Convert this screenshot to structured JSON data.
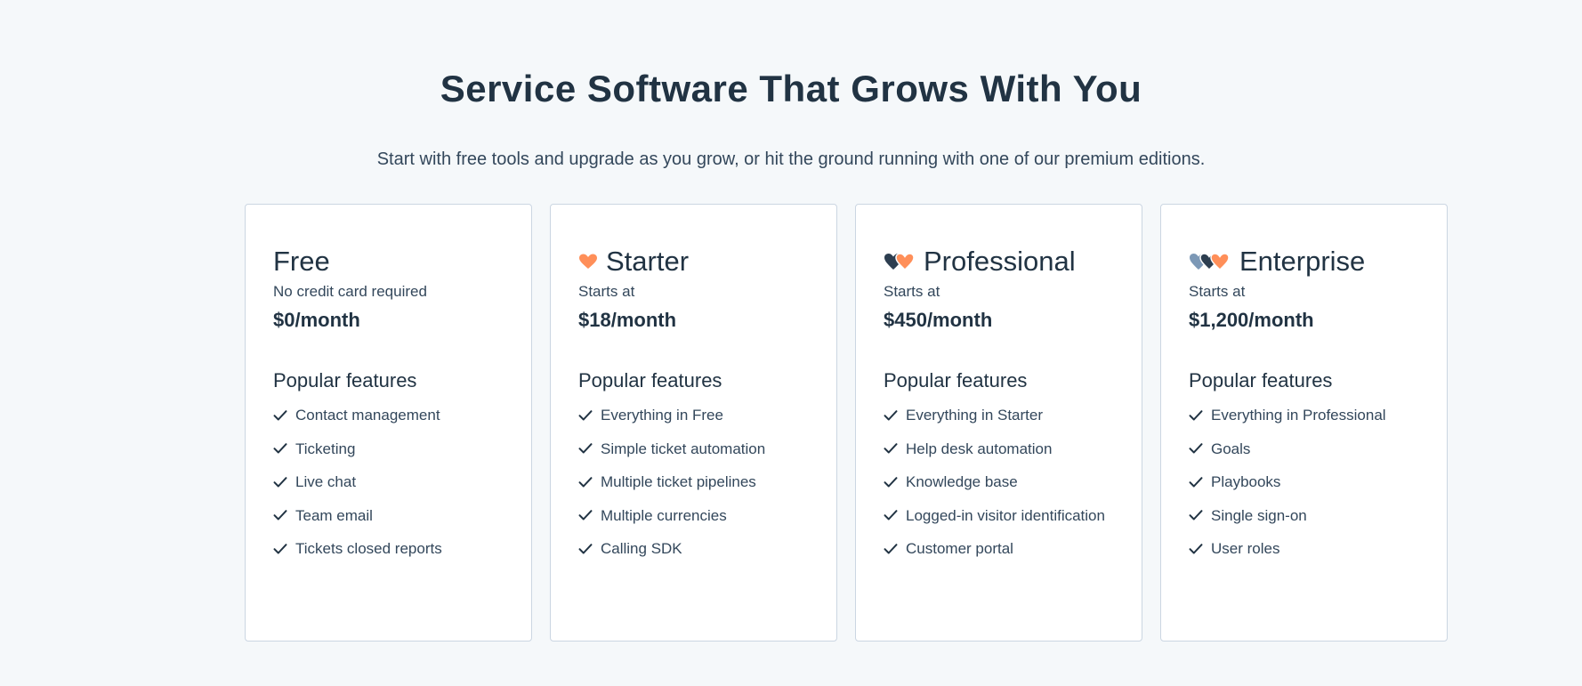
{
  "page": {
    "title": "Service Software That Grows With You",
    "subtitle": "Start with free tools and upgrade as you grow, or hit the ground running with one of our premium editions."
  },
  "colors": {
    "background": "#f5f8fa",
    "heading": "#213343",
    "text": "#33475b",
    "card_border": "#cbd6e2",
    "heart_orange": "#ff8f59",
    "heart_dark": "#2d3e50",
    "heart_gray": "#7c98b6"
  },
  "plans": [
    {
      "name": "Free",
      "icon": null,
      "subtext": "No credit card required",
      "price": "$0/month",
      "features_title": "Popular features",
      "features": [
        "Contact management",
        "Ticketing",
        "Live chat",
        "Team email",
        "Tickets closed reports"
      ]
    },
    {
      "name": "Starter",
      "icon": "heart-icon",
      "subtext": "Starts at",
      "price": "$18/month",
      "features_title": "Popular features",
      "features": [
        "Everything in Free",
        "Simple ticket automation",
        "Multiple ticket pipelines",
        "Multiple currencies",
        "Calling SDK"
      ]
    },
    {
      "name": "Professional",
      "icon": "two-hearts-icon",
      "subtext": "Starts at",
      "price": "$450/month",
      "features_title": "Popular features",
      "features": [
        "Everything in Starter",
        "Help desk automation",
        "Knowledge base",
        "Logged-in visitor identification",
        "Customer portal"
      ]
    },
    {
      "name": "Enterprise",
      "icon": "three-hearts-icon",
      "subtext": "Starts at",
      "price": "$1,200/month",
      "features_title": "Popular features",
      "features": [
        "Everything in Professional",
        "Goals",
        "Playbooks",
        "Single sign-on",
        "User roles"
      ]
    }
  ]
}
